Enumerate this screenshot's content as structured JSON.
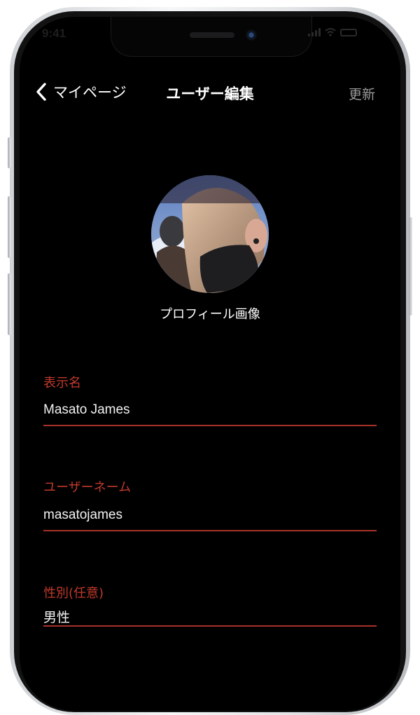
{
  "status_bar": {
    "time": "9:41"
  },
  "nav": {
    "back_label": "マイページ",
    "title": "ユーザー編集",
    "update_label": "更新"
  },
  "profile": {
    "avatar_caption": "プロフィール画像"
  },
  "fields": [
    {
      "label": "表示名",
      "value": "Masato James"
    },
    {
      "label": "ユーザーネーム",
      "value": "masatojames"
    },
    {
      "label": "性別(任意)",
      "value": "男性"
    }
  ],
  "colors": {
    "background": "#000000",
    "accent": "#c0392b",
    "text": "#ffffff",
    "muted": "#9a9a9a"
  },
  "icons": {
    "back": "chevron-left-icon"
  }
}
